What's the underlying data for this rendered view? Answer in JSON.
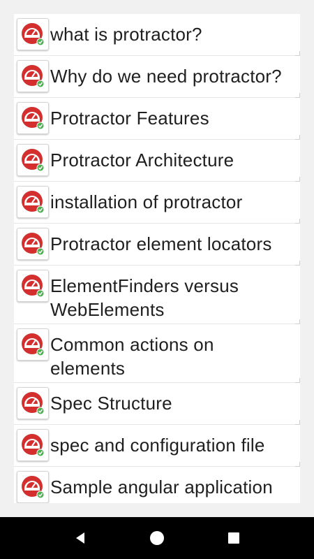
{
  "list": {
    "items": [
      {
        "label": "what is protractor?",
        "icon": "protractor-logo-icon"
      },
      {
        "label": "Why do we need protractor?",
        "icon": "protractor-logo-icon"
      },
      {
        "label": "Protractor Features",
        "icon": "protractor-logo-icon"
      },
      {
        "label": "Protractor Architecture",
        "icon": "protractor-logo-icon"
      },
      {
        "label": "installation of protractor",
        "icon": "protractor-logo-icon"
      },
      {
        "label": "Protractor element locators",
        "icon": "protractor-logo-icon"
      },
      {
        "label": "ElementFinders versus WebElements",
        "icon": "protractor-logo-icon"
      },
      {
        "label": "Common actions on elements",
        "icon": "protractor-logo-icon"
      },
      {
        "label": "Spec Structure",
        "icon": "protractor-logo-icon"
      },
      {
        "label": "spec and configuration file",
        "icon": "protractor-logo-icon"
      },
      {
        "label": "Sample angular application",
        "icon": "protractor-logo-icon"
      }
    ]
  },
  "navbar": {
    "back": "back-icon",
    "home": "home-icon",
    "recents": "recents-icon"
  },
  "colors": {
    "logo_red": "#d32f2f",
    "check_green": "#4caf50",
    "background": "#f1f1f1",
    "navbar": "#000000"
  }
}
